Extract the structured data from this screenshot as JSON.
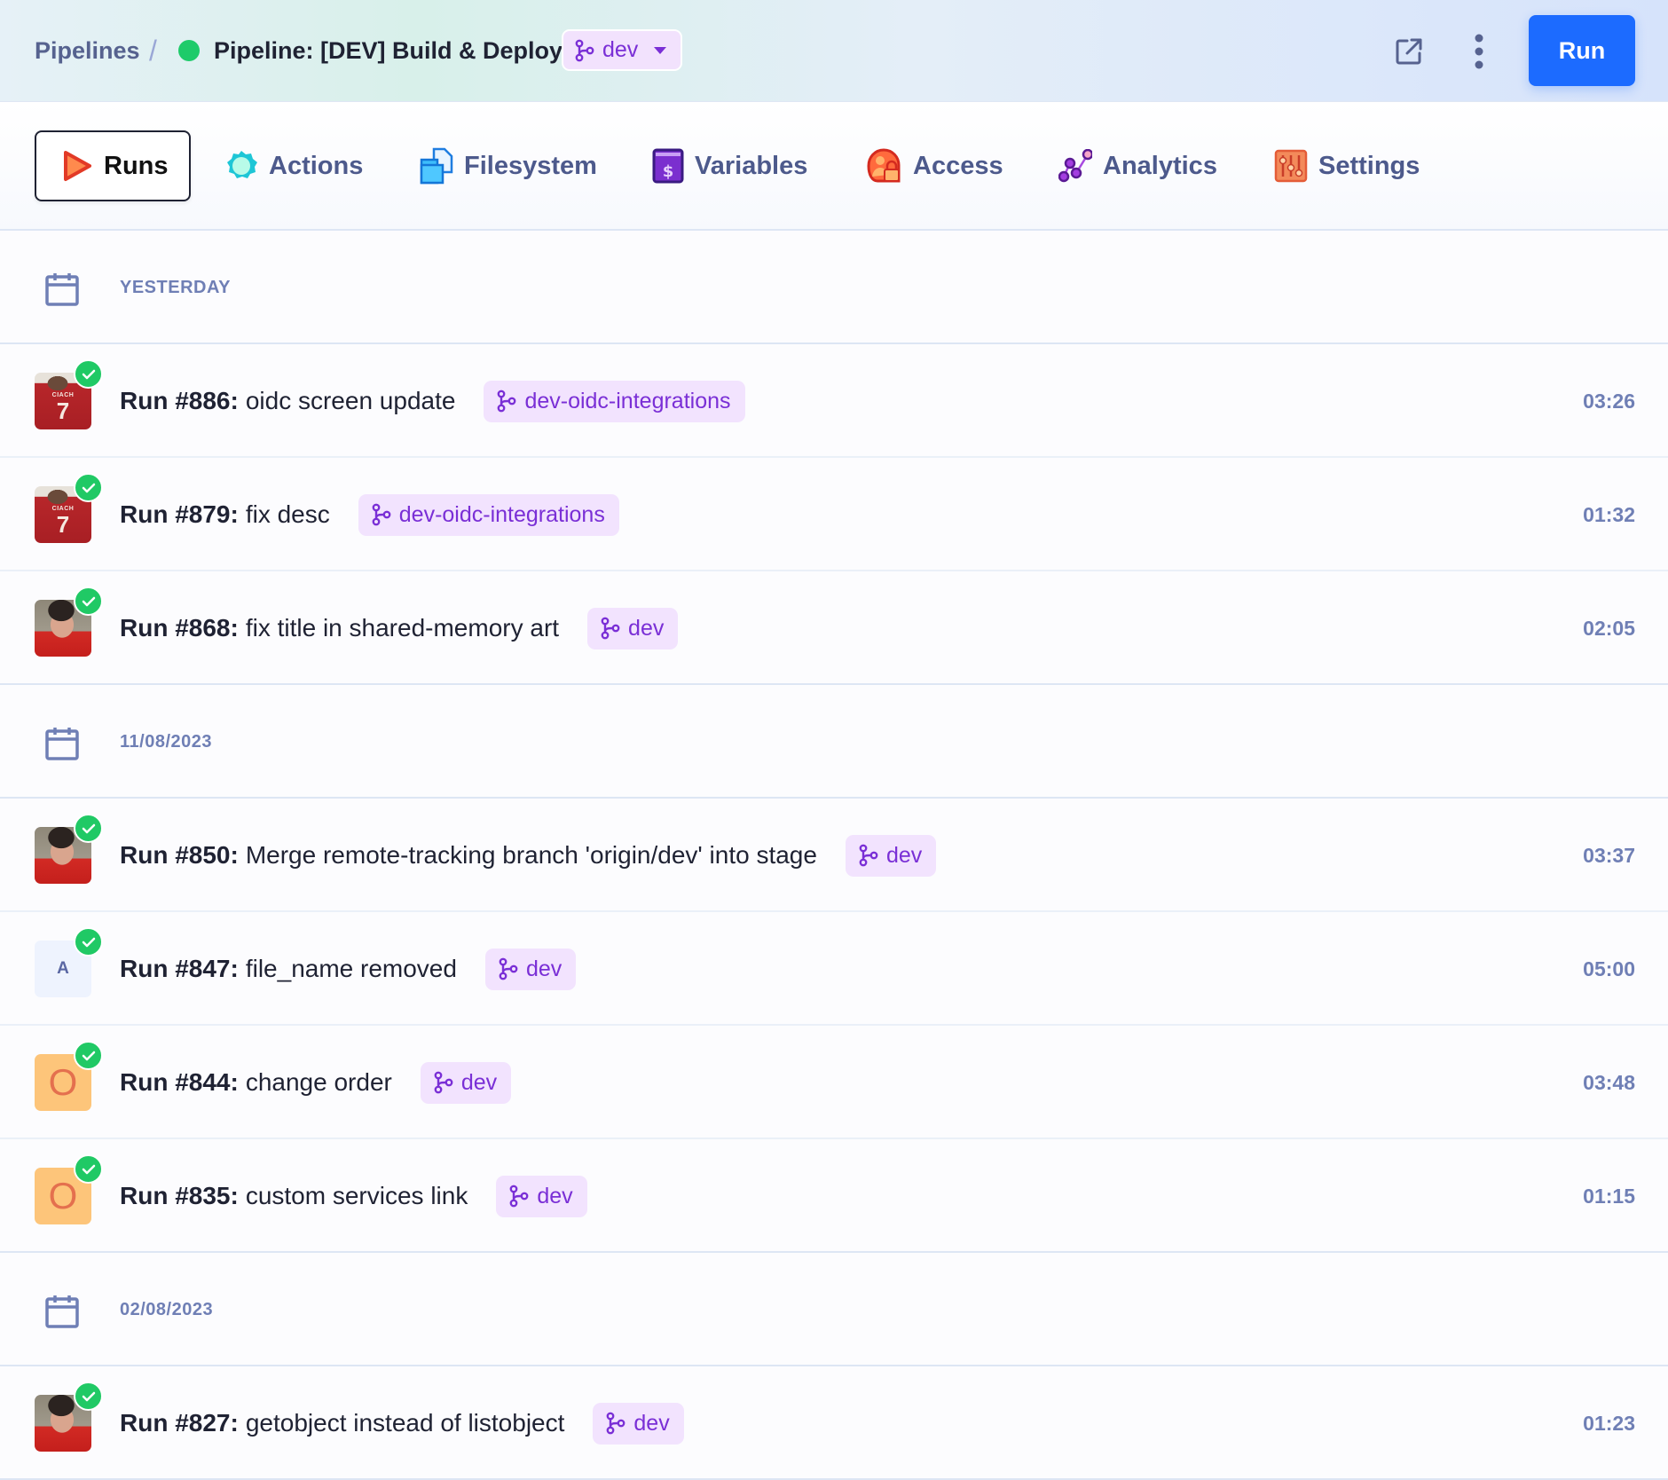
{
  "header": {
    "breadcrumb_root": "Pipelines",
    "breadcrumb_separator": "/",
    "pipeline_title": "Pipeline: [DEV] Build & Deploy",
    "pipeline_status": "active",
    "branch_selector": {
      "value": "dev",
      "icon": "git-branch-icon"
    },
    "external_link_icon": "external-link-icon",
    "more_menu_icon": "more-vertical-icon",
    "run_button_label": "Run"
  },
  "tabs": [
    {
      "label": "Runs",
      "icon": "play-icon",
      "active": true
    },
    {
      "label": "Actions",
      "icon": "gear-badge-icon",
      "active": false
    },
    {
      "label": "Filesystem",
      "icon": "file-folder-icon",
      "active": false
    },
    {
      "label": "Variables",
      "icon": "dollar-book-icon",
      "active": false
    },
    {
      "label": "Access",
      "icon": "user-lock-icon",
      "active": false
    },
    {
      "label": "Analytics",
      "icon": "chart-nodes-icon",
      "active": false
    },
    {
      "label": "Settings",
      "icon": "sliders-icon",
      "active": false
    }
  ],
  "groups": [
    {
      "date": "YESTERDAY",
      "runs": [
        {
          "number": "Run #886:",
          "message": "oidc screen update",
          "branch": "dev-oidc-integrations",
          "duration": "03:26",
          "status": "success",
          "avatar": "shirt"
        },
        {
          "number": "Run #879:",
          "message": "fix desc",
          "branch": "dev-oidc-integrations",
          "duration": "01:32",
          "status": "success",
          "avatar": "shirt"
        },
        {
          "number": "Run #868:",
          "message": "fix title in shared-memory art",
          "branch": "dev",
          "duration": "02:05",
          "status": "success",
          "avatar": "face"
        }
      ]
    },
    {
      "date": "11/08/2023",
      "runs": [
        {
          "number": "Run #850:",
          "message": "Merge remote-tracking branch 'origin/dev' into stage",
          "branch": "dev",
          "duration": "03:37",
          "status": "success",
          "avatar": "face"
        },
        {
          "number": "Run #847:",
          "message": "file_name removed",
          "branch": "dev",
          "duration": "05:00",
          "status": "success",
          "avatar": "A"
        },
        {
          "number": "Run #844:",
          "message": "change order",
          "branch": "dev",
          "duration": "03:48",
          "status": "success",
          "avatar": "O"
        },
        {
          "number": "Run #835:",
          "message": "custom services link",
          "branch": "dev",
          "duration": "01:15",
          "status": "success",
          "avatar": "O"
        }
      ]
    },
    {
      "date": "02/08/2023",
      "runs": [
        {
          "number": "Run #827:",
          "message": "getobject instead of listobject",
          "branch": "dev",
          "duration": "01:23",
          "status": "success",
          "avatar": "face"
        }
      ]
    }
  ],
  "colors": {
    "accent": "#1c6bff",
    "success": "#20c965",
    "branch_bg": "#f2e3fe",
    "branch_text": "#7a2fd6",
    "muted": "#6f7fb5"
  }
}
